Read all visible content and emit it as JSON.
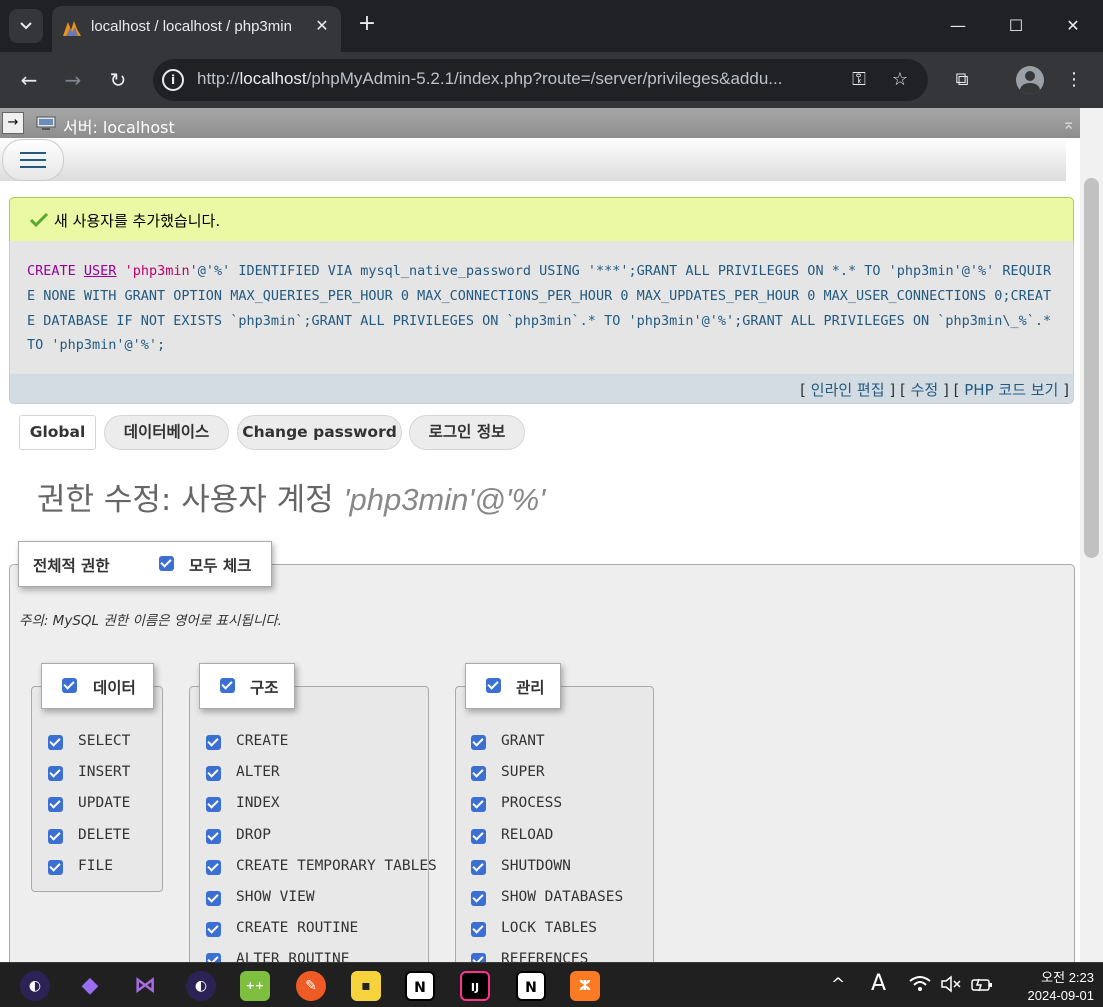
{
  "browser": {
    "tab_title": "localhost / localhost / php3min",
    "url_prefix": "http://",
    "url_host": "localhost",
    "url_path": "/phpMyAdmin-5.2.1/index.php?route=/server/privileges&addu...",
    "tab_menu_icon": "chevron-down-icon",
    "close_glyph": "✕",
    "new_tab_glyph": "+",
    "minimize_glyph": "—",
    "maximize_glyph": "☐",
    "window_close_glyph": "✕",
    "back_glyph": "←",
    "forward_glyph": "→",
    "reload_glyph": "↻",
    "info_glyph": "i",
    "key_glyph": "⚿",
    "star_glyph": "☆",
    "extensions_glyph": "⧉",
    "menu_glyph": "⋮"
  },
  "server_bar": {
    "arrow": "→",
    "label": "서버: localhost",
    "scroll_top_glyph": "⌅"
  },
  "success": {
    "message": "새 사용자를 추가했습니다."
  },
  "sql": {
    "kw_create": "CREATE",
    "kw_user": "USER",
    "user_str": "'php3min'",
    "rest": "@'%' IDENTIFIED VIA mysql_native_password USING '***';GRANT ALL PRIVILEGES ON *.* TO 'php3min'@'%' REQUIRE NONE WITH GRANT OPTION MAX_QUERIES_PER_HOUR 0 MAX_CONNECTIONS_PER_HOUR 0 MAX_UPDATES_PER_HOUR 0 MAX_USER_CONNECTIONS 0;CREATE DATABASE IF NOT EXISTS `php3min`;GRANT ALL PRIVILEGES ON `php3min`.* TO 'php3min'@'%';GRANT ALL PRIVILEGES ON `php3min\\_%`.* TO 'php3min'@'%';",
    "links": {
      "open": "[",
      "inline_edit": "인라인 편집",
      "sep1": "] [",
      "edit": "수정",
      "sep2": "] [",
      "php_code": "PHP 코드 보기",
      "close": "]"
    }
  },
  "tabs": [
    "Global",
    "데이터베이스",
    "Change password",
    "로그인 정보"
  ],
  "page_title": {
    "prefix": "권한 수정: 사용자 계정",
    "account": "'php3min'@'%'"
  },
  "global_privs": {
    "legend": "전체적 권한",
    "check_all": "모두 체크",
    "note": "주의: MySQL 권한 이름은 영어로 표시됩니다."
  },
  "groups": {
    "data": {
      "label": "데이터",
      "items": [
        "SELECT",
        "INSERT",
        "UPDATE",
        "DELETE",
        "FILE"
      ]
    },
    "structure": {
      "label": "구조",
      "items": [
        "CREATE",
        "ALTER",
        "INDEX",
        "DROP",
        "CREATE TEMPORARY TABLES",
        "SHOW VIEW",
        "CREATE ROUTINE",
        "ALTER ROUTINE"
      ]
    },
    "admin": {
      "label": "관리",
      "items": [
        "GRANT",
        "SUPER",
        "PROCESS",
        "RELOAD",
        "SHUTDOWN",
        "SHOW DATABASES",
        "LOCK TABLES",
        "REFERENCES"
      ]
    }
  },
  "taskbar": {
    "apps": [
      "eclipse",
      "obsidian",
      "visual-studio",
      "eclipse",
      "notepad-plus-plus",
      "postman",
      "sticky-notes",
      "notion",
      "intellij",
      "notion",
      "xampp"
    ],
    "tray_chevron": "^",
    "tray_ime": "A",
    "clock_time": "오전 2:23",
    "clock_date": "2024-09-01"
  }
}
